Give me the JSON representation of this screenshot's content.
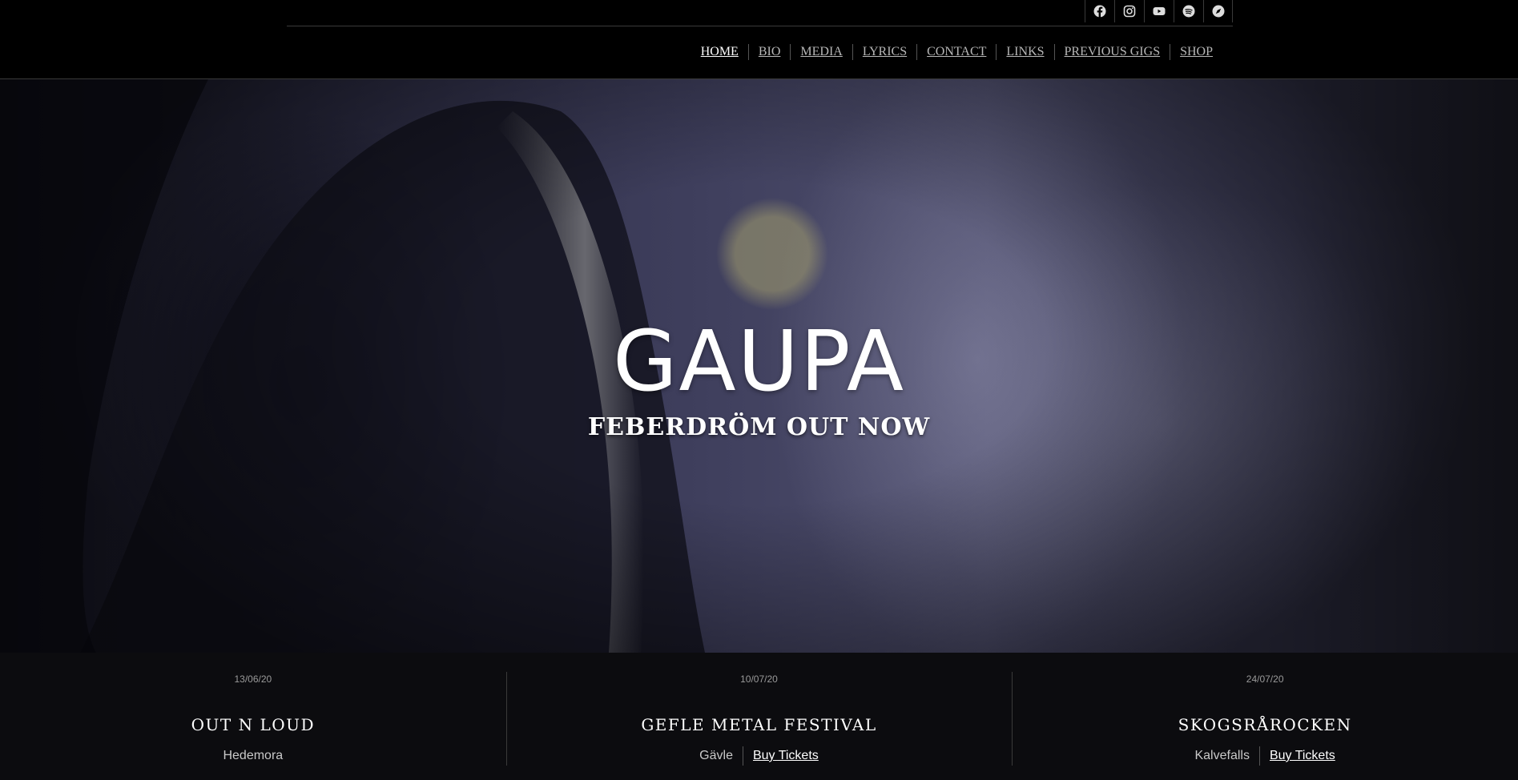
{
  "social": [
    {
      "name": "facebook-icon"
    },
    {
      "name": "instagram-icon"
    },
    {
      "name": "youtube-icon"
    },
    {
      "name": "spotify-icon"
    },
    {
      "name": "compass-icon"
    }
  ],
  "nav": {
    "items": [
      "HOME",
      "BIO",
      "MEDIA",
      "LYRICS",
      "CONTACT",
      "LINKS",
      "PREVIOUS GIGS",
      "SHOP"
    ],
    "active": "HOME"
  },
  "hero": {
    "title": "GAUPA",
    "subtitle": "FEBERDRÖM OUT NOW"
  },
  "gigs": [
    {
      "date": "13/06/20",
      "name": "OUT N LOUD",
      "city": "Hedemora",
      "tickets": ""
    },
    {
      "date": "10/07/20",
      "name": "GEFLE METAL FESTIVAL",
      "city": "Gävle",
      "tickets": "Buy Tickets"
    },
    {
      "date": "24/07/20",
      "name": "SKOGSRÅROCKEN",
      "city": "Kalvefalls",
      "tickets": "Buy Tickets"
    }
  ],
  "colors": {
    "background": "#000000",
    "text": "#ffffff",
    "muted": "#b7b7b7",
    "divider": "#3a3a3a"
  }
}
